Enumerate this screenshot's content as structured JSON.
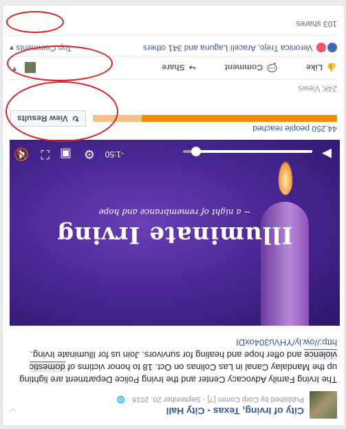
{
  "post": {
    "page_name": "City of Irving, Texas - City Hall",
    "published_by": "Published by Corp Comm [?] · September 20, 2016 ·",
    "body_part1": "The Irving Family Advocacy Center and the Irving Police Department are lighting up the Mandalay Canal in Las Colinas on Oct. 18 to honor victims of ",
    "body_highlight": "domestic violence",
    "body_part2": " and offer hope and healing for survivors. Join us for Illuminate Irving. ",
    "body_link": "http://ow.ly/YHVu304oxDI"
  },
  "video": {
    "title": "Illuminate Irving",
    "subtitle": "~ a night of remembrance and hope",
    "time_remaining": "-1:50",
    "progress": 0.9
  },
  "stats": {
    "people_reached": "44,250 people reached",
    "reach_fill": 0.8,
    "view_results_label": "View Results",
    "views": "24K Views"
  },
  "actions": {
    "like": "Like",
    "comment": "Comment",
    "share": "Share"
  },
  "reactions": {
    "names": "Veronica Trejo, Aracelí Laguna and 341 others",
    "top_comments": "Top Comments",
    "shares": "103 shares"
  },
  "colors": {
    "link_blue": "#365899",
    "orange": "#f08c00",
    "highlight_ring": "#d91e26"
  }
}
